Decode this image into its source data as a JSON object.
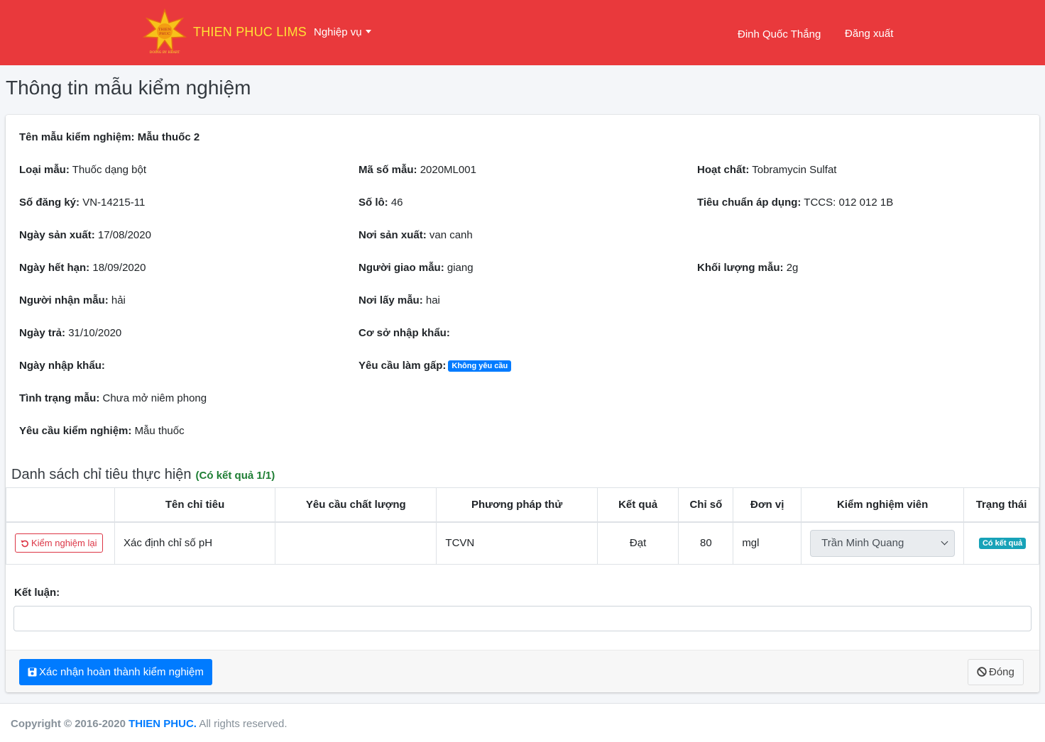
{
  "nav": {
    "brand": "THIEN PHUC LIMS",
    "logo_text_top": "THIEN",
    "logo_text_mid": "PHUC",
    "logo_tagline": "DOING BY HEART",
    "menu": "Nghiệp vụ",
    "user": "Đinh Quốc Thắng",
    "logout": "Đăng xuất"
  },
  "page_title": "Thông tin mẫu kiểm nghiệm",
  "sample": {
    "name_label": "Tên mẫu kiểm nghiệm:",
    "name_value": "Mẫu thuốc 2",
    "fields": [
      {
        "label": "Loại mẫu:",
        "value": "Thuốc dạng bột"
      },
      {
        "label": "Mã số mẫu:",
        "value": "2020ML001"
      },
      {
        "label": "Hoạt chất:",
        "value": "Tobramycin Sulfat"
      },
      {
        "label": "Số đăng ký:",
        "value": "VN-14215-11"
      },
      {
        "label": "Số lô:",
        "value": "46"
      },
      {
        "label": "Tiêu chuẩn áp dụng:",
        "value": "TCCS: 012 012 1B"
      },
      {
        "label": "Ngày sản xuất:",
        "value": "17/08/2020"
      },
      {
        "label": "Nơi sản xuất:",
        "value": "van canh"
      },
      {
        "label": "Ngày hết hạn:",
        "value": "18/09/2020"
      },
      {
        "label": "Người giao mẫu:",
        "value": "giang"
      },
      {
        "label": "Khối lượng mẫu:",
        "value": "2g"
      },
      {
        "label": "Người nhận mẫu:",
        "value": "hải"
      },
      {
        "label": "Nơi lấy mẫu:",
        "value": "hai"
      },
      {
        "label": "Ngày trả:",
        "value": "31/10/2020"
      },
      {
        "label": "Cơ sở nhập khẩu:",
        "value": ""
      },
      {
        "label": "Ngày nhập khẩu:",
        "value": ""
      },
      {
        "label": "Yêu cầu làm gấp:",
        "value": ""
      },
      {
        "label": "Tình trạng mẫu:",
        "value": "Chưa mở niêm phong"
      },
      {
        "label": "Yêu cầu kiểm nghiệm:",
        "value": "Mẫu thuốc"
      }
    ],
    "urgent_badge": "Không yêu cầu"
  },
  "criteria": {
    "title": "Danh sách chỉ tiêu thực hiện",
    "result_summary": "(Có kết quả 1/1)",
    "headers": [
      "",
      "Tên chỉ tiêu",
      "Yêu cầu chất lượng",
      "Phương pháp thử",
      "Kết quả",
      "Chỉ số",
      "Đơn vị",
      "Kiểm nghiệm viên",
      "Trạng thái"
    ],
    "rows": [
      {
        "action": "Kiểm nghiệm lại",
        "name": "Xác định chỉ số pH",
        "quality": "",
        "method": "TCVN",
        "result": "Đạt",
        "index": "80",
        "unit": "mgl",
        "tester": "Trần Minh Quang",
        "status": "Có kết quả"
      }
    ]
  },
  "conclusion": {
    "label": "Kết luận:",
    "value": ""
  },
  "actions": {
    "confirm": "Xác nhận hoàn thành kiểm nghiệm",
    "close": "Đóng"
  },
  "footer": {
    "copyright": "Copyright © 2016-2020",
    "brand": "THIEN PHUC.",
    "rights": "All rights reserved."
  },
  "colors": {
    "navbar": "#e9393c",
    "brand": "#ffe135",
    "primary": "#007bff",
    "danger": "#dc3545",
    "info": "#17a2b8"
  }
}
